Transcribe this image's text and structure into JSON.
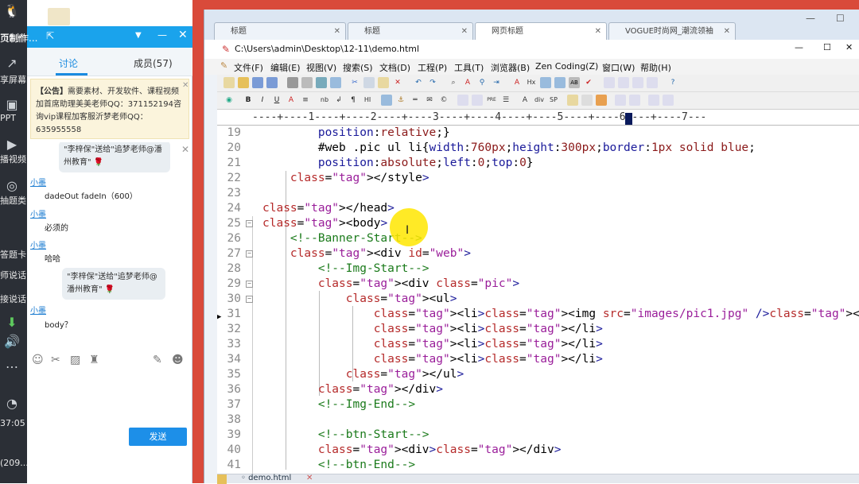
{
  "left_strip": {
    "top_label": "页制作...",
    "items": [
      "享屏幕",
      "PPT",
      "播视频",
      "抽题类",
      "答题卡",
      "师说话",
      "接说话"
    ],
    "time": "37:05",
    "bottom_label": "(209..."
  },
  "chat": {
    "header_title": "页制作...",
    "tab_discuss": "讨论",
    "tab_members": "成员(57)",
    "notice_label": "【公告】",
    "notice_text": "需要素材、开发软件、课程视频加首席助理美美老师QQ：371152194咨询vip课程加客服沂梦老师QQ：635955558",
    "messages": [
      {
        "type": "bubble",
        "text": "\"李梓保\"送给\"追梦老师@潘州教育\" 🌹"
      },
      {
        "type": "user",
        "name": "小墨",
        "text": "dadeOut fadeIn（600）"
      },
      {
        "type": "user",
        "name": "小墨",
        "text": "必须的"
      },
      {
        "type": "user",
        "name": "小墨",
        "text": "哈哈"
      },
      {
        "type": "bubble",
        "text": "\"李梓保\"送给\"追梦老师@潘州教育\" 🌹"
      },
      {
        "type": "user",
        "name": "小墨",
        "text": "body？"
      }
    ],
    "send_label": "发送"
  },
  "editor": {
    "browser_tabs": [
      {
        "label": "标题"
      },
      {
        "label": "标题"
      },
      {
        "label": "网页标题"
      },
      {
        "label": "VOGUE时尚网_潮流领袖"
      }
    ],
    "file_path": "C:\\Users\\admin\\Desktop\\12-11\\demo.html",
    "menus": [
      "文件(F)",
      "编辑(E)",
      "视图(V)",
      "搜索(S)",
      "文档(D)",
      "工程(P)",
      "工具(T)",
      "浏览器(B)",
      "Zen Coding(Z)",
      "窗口(W)",
      "帮助(H)"
    ],
    "ruler": "----+----1----+----2----+----3----+----4----+----5----+----6----+----7---",
    "file_tab": "demo.html",
    "lines": [
      {
        "n": "19",
        "code": "        position:relative;}"
      },
      {
        "n": "20",
        "code": "        #web .pic ul li{width:760px;height:300px;border:1px solid blue;"
      },
      {
        "n": "21",
        "code": "        position:absolute;left:0;top:0}"
      },
      {
        "n": "22",
        "code": "    </style>"
      },
      {
        "n": "23",
        "code": ""
      },
      {
        "n": "24",
        "code": "</head>"
      },
      {
        "n": "25",
        "code": "<body>"
      },
      {
        "n": "26",
        "code": "    <!--Banner-Start-->"
      },
      {
        "n": "27",
        "code": "    <div id=\"web\">"
      },
      {
        "n": "28",
        "code": "        <!--Img-Start-->"
      },
      {
        "n": "29",
        "code": "        <div class=\"pic\">"
      },
      {
        "n": "30",
        "code": "            <ul>"
      },
      {
        "n": "31",
        "code": "                <li><img src=\"images/pic1.jpg\" /></li>"
      },
      {
        "n": "32",
        "code": "                <li></li>"
      },
      {
        "n": "33",
        "code": "                <li></li>"
      },
      {
        "n": "34",
        "code": "                <li></li>"
      },
      {
        "n": "35",
        "code": "            </ul>"
      },
      {
        "n": "36",
        "code": "        </div>"
      },
      {
        "n": "37",
        "code": "        <!--Img-End-->"
      },
      {
        "n": "38",
        "code": ""
      },
      {
        "n": "39",
        "code": "        <!--btn-Start-->"
      },
      {
        "n": "40",
        "code": "        <div></div>"
      },
      {
        "n": "41",
        "code": "        <!--btn-End-->"
      }
    ]
  }
}
